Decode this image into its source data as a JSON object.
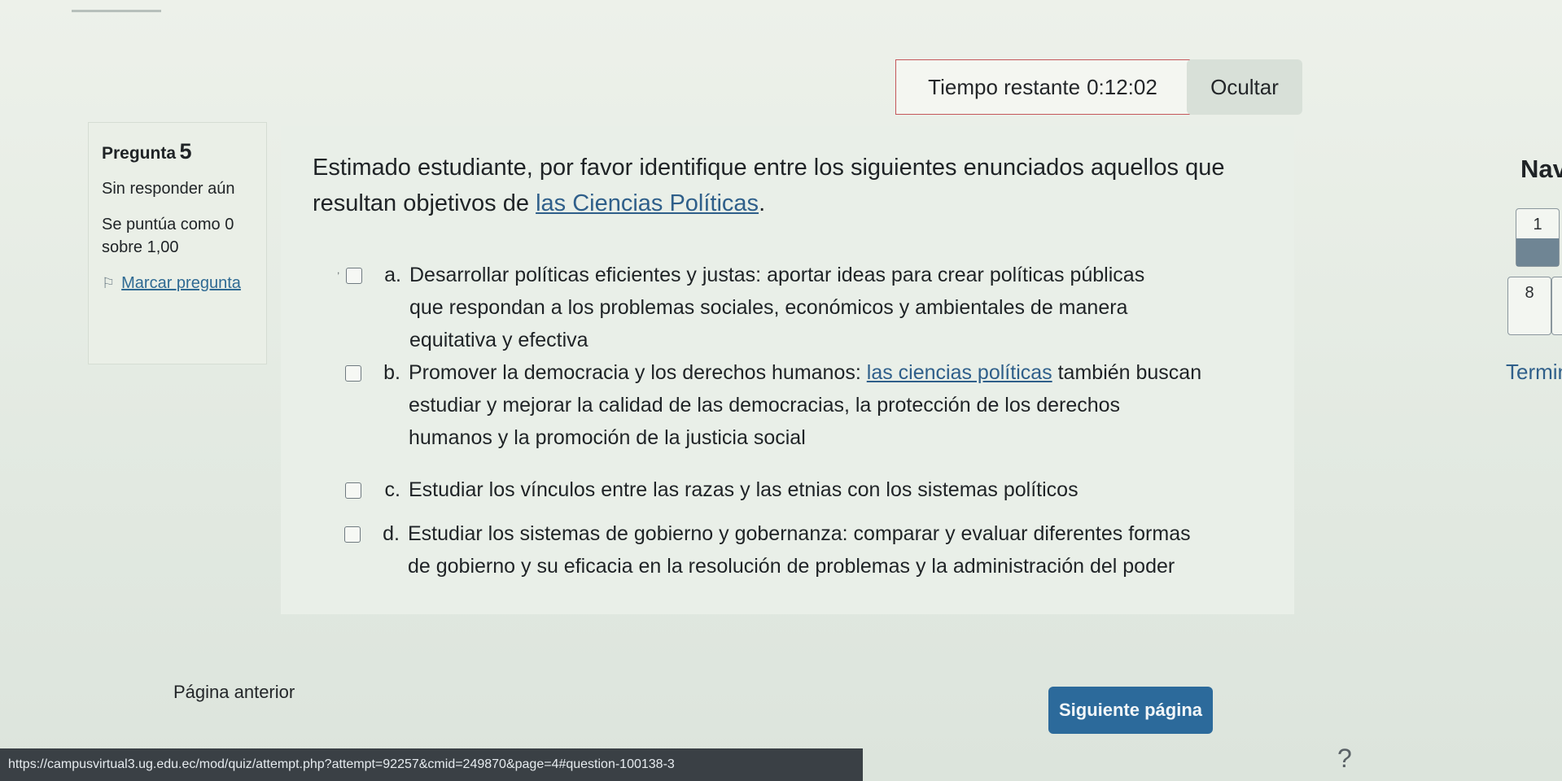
{
  "timer": {
    "label": "Tiempo restante",
    "value": "0:12:02",
    "hide_label": "Ocultar"
  },
  "question_info": {
    "label": "Pregunta",
    "number": "5",
    "status": "Sin responder aún",
    "grade": "Se puntúa como 0 sobre 1,00",
    "flag_label": "Marcar pregunta"
  },
  "question": {
    "text_before": "Estimado estudiante, por favor identifique entre los siguientes enunciados aquellos que resultan objetivos de",
    "text_link": "las Ciencias Políticas",
    "text_after": "."
  },
  "options": [
    {
      "letter": "a.",
      "text": "Desarrollar políticas eficientes y justas: aportar ideas para crear políticas públicas que respondan a los problemas sociales, económicos y ambientales de manera equitativa y efectiva"
    },
    {
      "letter": "b.",
      "text_before": "Promover la democracia y los derechos humanos:",
      "text_link": "las ciencias políticas",
      "text_after": "también buscan estudiar y mejorar la calidad de las democracias, la protección de los derechos humanos y la promoción de la justicia social"
    },
    {
      "letter": "c.",
      "text": "Estudiar los vínculos entre las razas y las etnias con los sistemas políticos"
    },
    {
      "letter": "d.",
      "text": "Estudiar los sistemas de gobierno y gobernanza: comparar y evaluar diferentes formas de gobierno y su eficacia en la resolución de problemas y la administración del poder"
    }
  ],
  "navigation": {
    "title": "Nav",
    "buttons": [
      "1",
      "8"
    ],
    "finish_label": "Termin"
  },
  "footer": {
    "prev_label": "Página anterior",
    "next_label": "Siguiente página",
    "status_url": "https://campusvirtual3.ug.edu.ec/mod/quiz/attempt.php?attempt=92257&cmid=249870&page=4#question-100138-3"
  },
  "colors": {
    "accent": "#2c6a9b",
    "link": "#2f5f8a",
    "timer_border": "#c4565a"
  }
}
